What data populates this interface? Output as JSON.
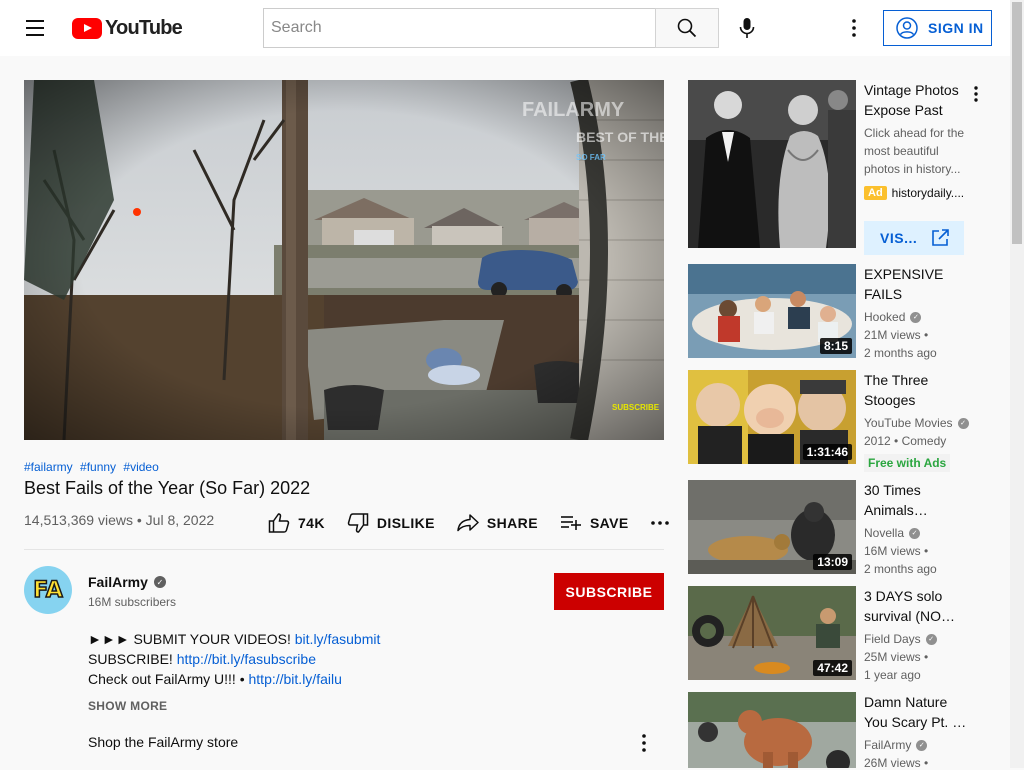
{
  "header": {
    "logo_text": "YouTube",
    "search_placeholder": "Search",
    "signin_label": "SIGN IN"
  },
  "video": {
    "hashtags": [
      "#failarmy",
      "#funny",
      "#video"
    ],
    "title": "Best Fails of the Year (So Far) 2022",
    "views": "14,513,369 views",
    "date": "Jul 8, 2022",
    "meta_separator": "•",
    "likes": "74K",
    "dislike_label": "DISLIKE",
    "share_label": "SHARE",
    "save_label": "SAVE",
    "watermark": "FAILARMY",
    "watermark_sub": "BEST OF THE YEAR",
    "watermark_sub2": "SO FAR",
    "subscribe_tag": "SUBSCRIBE"
  },
  "channel": {
    "avatar_text": "FA",
    "name": "FailArmy",
    "subscribers": "16M subscribers",
    "subscribe_label": "SUBSCRIBE"
  },
  "description": {
    "line1_text": "►►► SUBMIT YOUR VIDEOS! ",
    "line1_link": "bit.ly/fasubmit",
    "line2_text": "SUBSCRIBE! ",
    "line2_link": "http://bit.ly/fasubscribe",
    "line3_text": "Check out FailArmy U!!! • ",
    "line3_link": "http://bit.ly/failu",
    "show_more": "SHOW MORE",
    "shop": "Shop the FailArmy store"
  },
  "ad": {
    "title": "Vintage Photos Expose Past",
    "description": "Click ahead for the most beautiful photos in history...",
    "badge": "Ad",
    "domain": "historydaily....",
    "cta": "VIS..."
  },
  "recommendations": [
    {
      "title": "EXPENSIVE FAILS",
      "channel": "Hooked",
      "views": "21M views •",
      "age": "2 months ago",
      "duration": "8:15"
    },
    {
      "title": "The Three Stooges",
      "channel": "YouTube Movies",
      "views": "2012 • Comedy",
      "age": "",
      "free": "Free with Ads",
      "duration": "1:31:46"
    },
    {
      "title": "30 Times Animals…",
      "channel": "Novella",
      "views": "16M views •",
      "age": "2 months ago",
      "duration": "13:09"
    },
    {
      "title": "3 DAYS solo survival (NO…",
      "channel": "Field Days",
      "views": "25M views •",
      "age": "1 year ago",
      "duration": "47:42"
    },
    {
      "title": "Damn Nature You Scary Pt. …",
      "channel": "FailArmy",
      "views": "26M views •",
      "age": "",
      "duration": ""
    }
  ],
  "colors": {
    "brand_red": "#ff0000",
    "subscribe_red": "#cc0000",
    "link_blue": "#065fd4",
    "free_green": "#2ba640"
  }
}
